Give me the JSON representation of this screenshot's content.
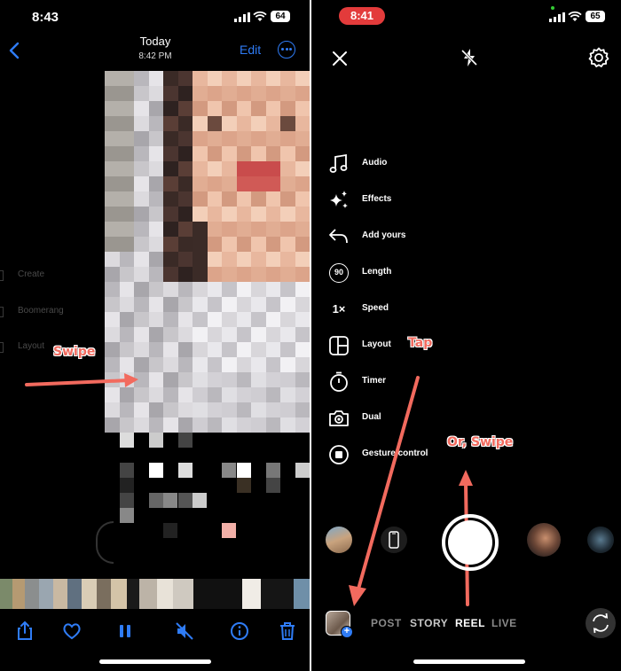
{
  "left": {
    "status": {
      "time": "8:43",
      "battery": "64"
    },
    "nav": {
      "title": "Today",
      "subtitle": "8:42 PM",
      "edit_label": "Edit"
    },
    "ghost_menu": [
      "Create",
      "Boomerang",
      "Layout"
    ],
    "annotation": "Swipe",
    "toolbar_icons": [
      "share-icon",
      "heart-icon",
      "pause-icon",
      "mute-icon",
      "info-icon",
      "trash-icon"
    ]
  },
  "right": {
    "status": {
      "time": "8:41",
      "battery": "65"
    },
    "top_icons": [
      "close-icon",
      "flash-off-icon",
      "gear-icon"
    ],
    "menu": [
      {
        "icon": "music-icon",
        "label": "Audio"
      },
      {
        "icon": "sparkles-icon",
        "label": "Effects"
      },
      {
        "icon": "reply-arrow-icon",
        "label": "Add yours"
      },
      {
        "icon": "length-90-icon",
        "label": "Length",
        "icon_text": "90"
      },
      {
        "icon": "speed-icon",
        "label": "Speed",
        "icon_text": "1×"
      },
      {
        "icon": "layout-icon",
        "label": "Layout"
      },
      {
        "icon": "timer-icon",
        "label": "Timer"
      },
      {
        "icon": "dual-camera-icon",
        "label": "Dual"
      },
      {
        "icon": "gesture-control-icon",
        "label": "Gesture control"
      }
    ],
    "annotations": {
      "tap": "Tap",
      "swipe": "Or, Swipe"
    },
    "modes": [
      {
        "label": "POST",
        "active": false
      },
      {
        "label": "STORY",
        "active": false
      },
      {
        "label": "REEL",
        "active": true
      },
      {
        "label": "LIVE",
        "active": false
      }
    ]
  },
  "colors": {
    "ios_blue": "#2f7cf6",
    "annotation_red": "#f26a5e",
    "recording_red": "#e33b3b"
  }
}
